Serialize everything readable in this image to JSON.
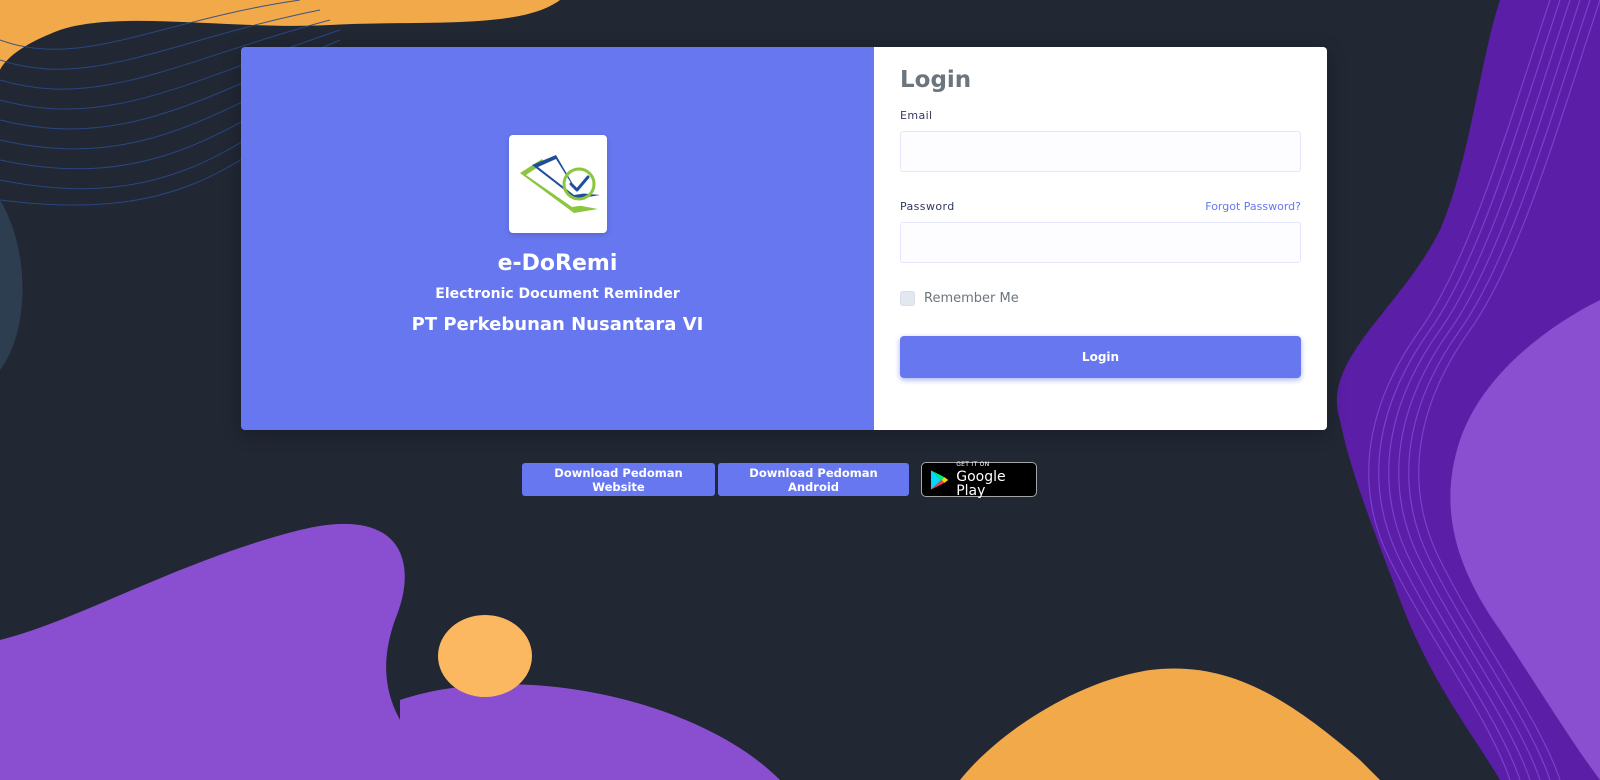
{
  "brand": {
    "app_name": "e-DoRemi",
    "subtitle": "Electronic Document Reminder",
    "company": "PT Perkebunan Nusantara VI",
    "logo_icon": "document-check-icon"
  },
  "login": {
    "title": "Login",
    "email_label": "Email",
    "email_value": "",
    "password_label": "Password",
    "password_value": "",
    "forgot_password": "Forgot Password?",
    "remember_me": "Remember Me",
    "remember_checked": false,
    "submit_label": "Login"
  },
  "downloads": {
    "website_guide": "Download Pedoman Website",
    "android_guide": "Download Pedoman Android",
    "google_play": {
      "small_text": "GET IT ON",
      "big_text": "Google Play",
      "icon": "google-play-icon"
    }
  },
  "colors": {
    "accent": "#6777ef",
    "background": "#212733",
    "blob_purple": "#8a4fd0",
    "blob_orange": "#f2a94a",
    "logo_blue": "#1f4f9c",
    "logo_green": "#8cc63f"
  }
}
